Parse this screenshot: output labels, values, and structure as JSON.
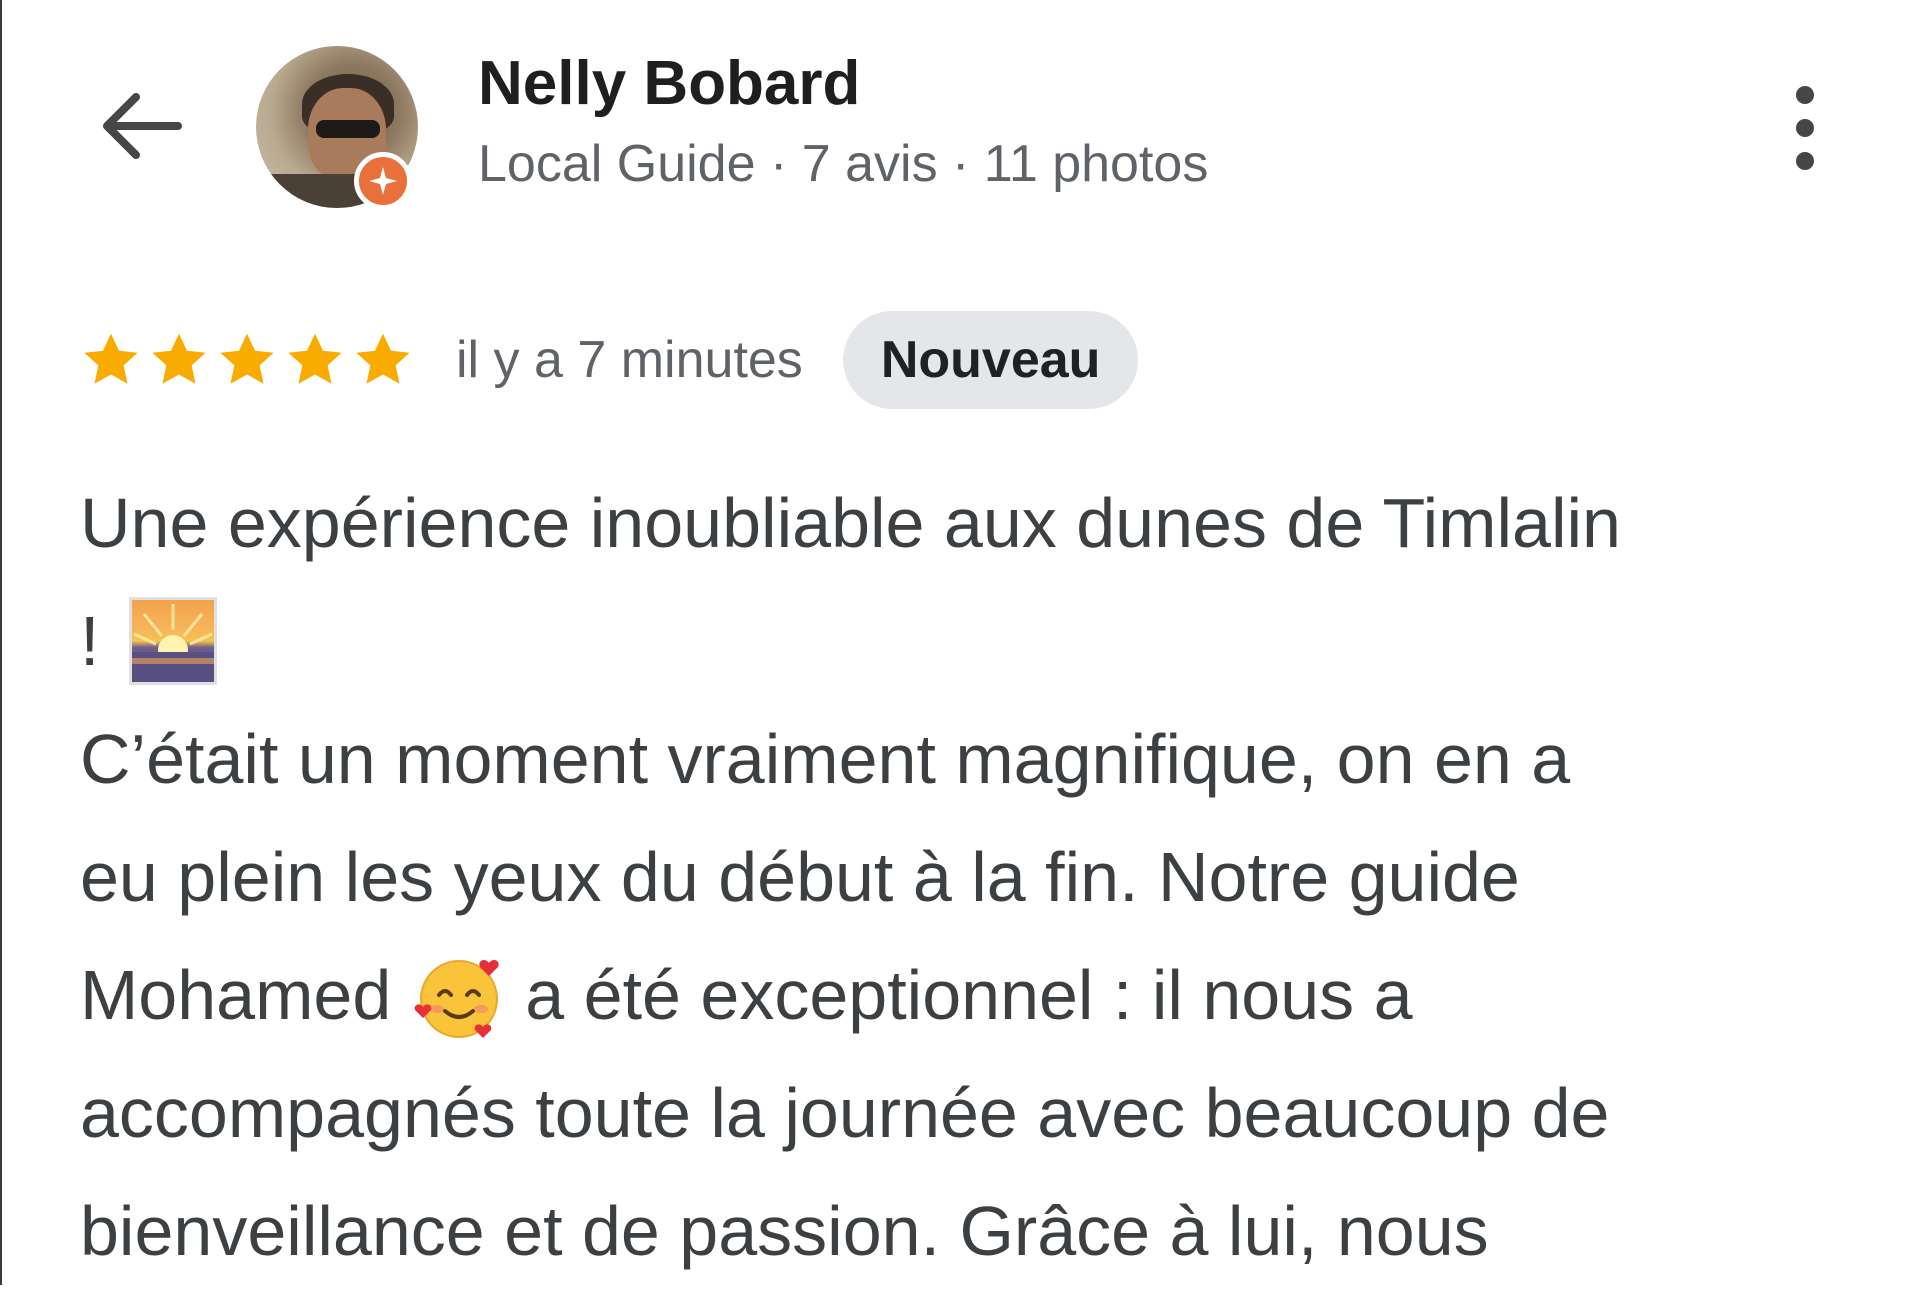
{
  "header": {
    "back_icon": "arrow-left-icon",
    "user_name": "Nelly Bobard",
    "user_meta": "Local Guide · 7 avis · 11 photos",
    "more_icon": "more-vert-icon",
    "badge_icon": "local-guide-badge-icon"
  },
  "review": {
    "rating": 5,
    "rating_max": 5,
    "star_color": "#F9AB00",
    "time_ago": "il y a 7 minutes",
    "new_badge": "Nouveau",
    "lines": [
      "Une expérience inoubliable aux dunes de Timlalin",
      "!",
      "C’était un moment vraiment magnifique, on en a",
      "eu plein les yeux du début à la fin. Notre guide",
      "Mohamed",
      "a été exceptionnel : il nous a",
      "accompagnés toute la journée avec beaucoup de",
      "bienveillance et de passion. Grâce à lui, nous"
    ],
    "emojis": [
      "sunrise-emoji",
      "smiling-face-with-hearts-emoji"
    ]
  }
}
